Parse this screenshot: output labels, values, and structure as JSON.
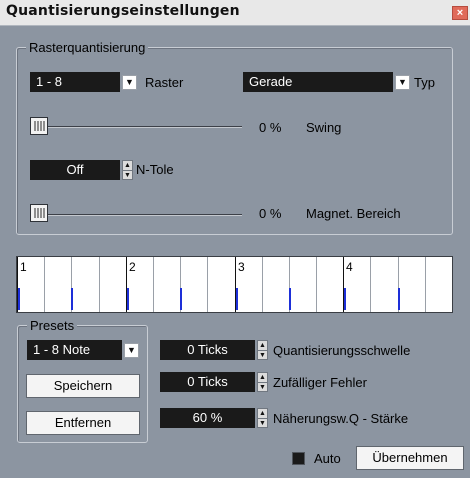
{
  "window": {
    "title": "Quantisierungseinstellungen",
    "close_glyph": "×"
  },
  "raster_group": {
    "legend": "Rasterquantisierung",
    "raster_value": "1 - 8",
    "raster_label": "Raster",
    "typ_value": "Gerade",
    "typ_label": "Typ",
    "swing_value": "0 %",
    "swing_label": "Swing",
    "swing_level": 0,
    "ntole_value": "Off",
    "ntole_label": "N-Tole",
    "magnet_value": "0 %",
    "magnet_label": "Magnet. Bereich",
    "magnet_level": 0
  },
  "ruler": {
    "bars": [
      "1",
      "2",
      "3",
      "4"
    ]
  },
  "presets": {
    "legend": "Presets",
    "value": "1 - 8 Note",
    "save_label": "Speichern",
    "remove_label": "Entfernen"
  },
  "params": [
    {
      "value": "0 Ticks",
      "label": "Quantisierungsschwelle"
    },
    {
      "value": "0 Ticks",
      "label": "Zufälliger Fehler"
    },
    {
      "value": "60 %",
      "label": "Näherungsw.Q - Stärke"
    }
  ],
  "footer": {
    "auto_label": "Auto",
    "auto_checked": false,
    "apply_label": "Übernehmen"
  },
  "colors": {
    "background": "#8c95a1",
    "field": "#1a1a1a",
    "beat_marker": "#1d2fd8"
  },
  "icons": {
    "dropdown": "chevron-down-icon",
    "spinner": "spinner-arrows-icon",
    "close": "close-icon"
  }
}
